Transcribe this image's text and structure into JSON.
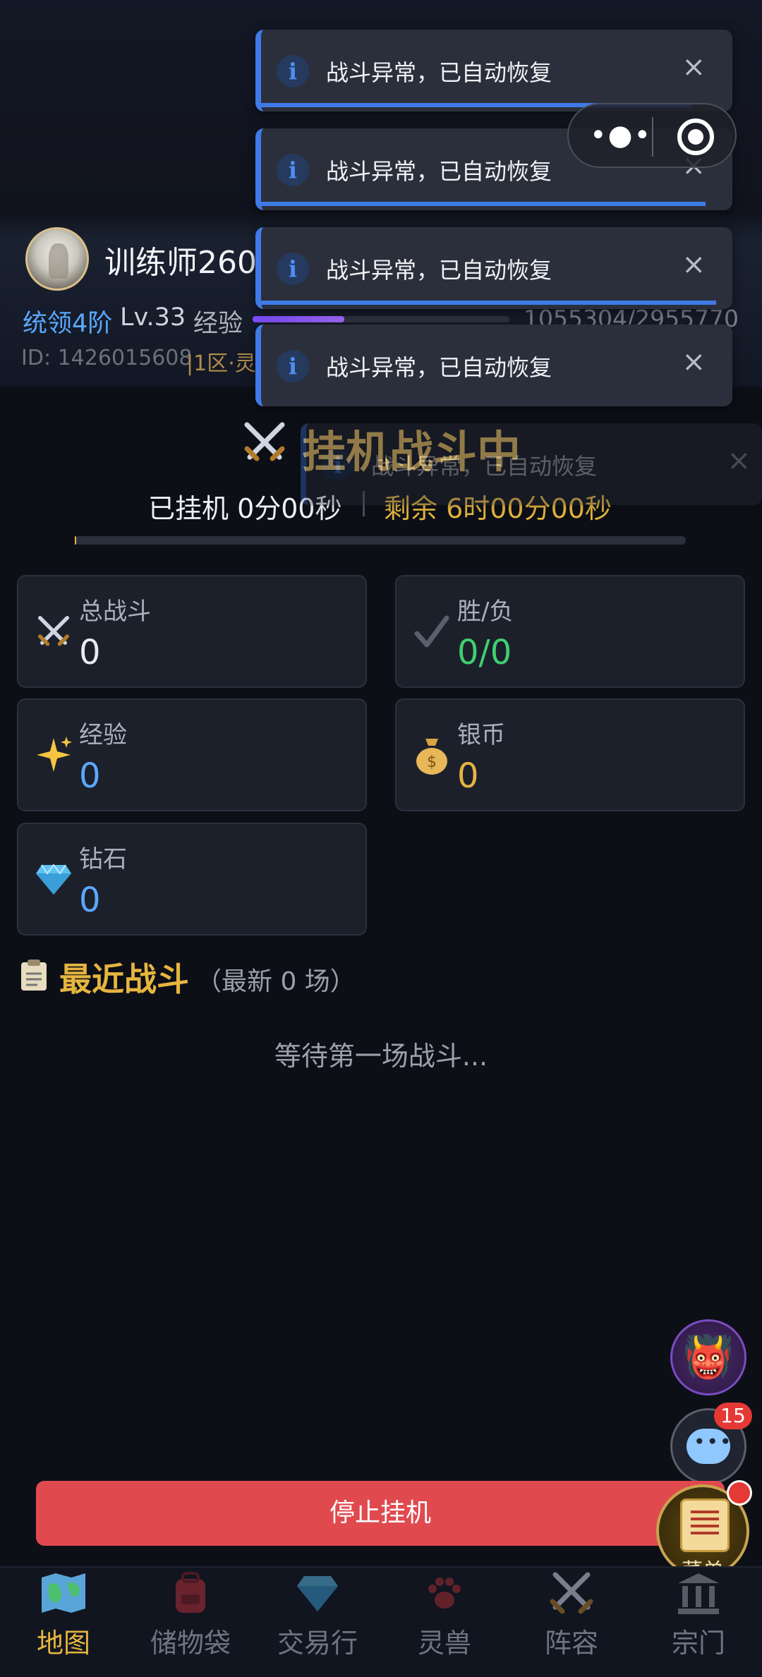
{
  "player": {
    "name": "训练师260",
    "rank": "统领4阶",
    "level": "Lv.33",
    "exp_label": "经验",
    "exp_value": "1055304/2955770",
    "exp_fraction": 0.357,
    "id": "ID: 1426015608",
    "server": "|1区·灵"
  },
  "battle": {
    "status": "挂机战斗中",
    "elapsed": "已挂机 0分00秒",
    "remaining": "剩余 6时00分00秒",
    "progress": 0
  },
  "stats": {
    "total": {
      "label": "总战斗",
      "value": "0"
    },
    "winloss": {
      "label": "胜/负",
      "value": "0/0"
    },
    "exp": {
      "label": "经验",
      "value": "0"
    },
    "silver": {
      "label": "银币",
      "value": "0"
    },
    "diamond": {
      "label": "钻石",
      "value": "0"
    }
  },
  "recent": {
    "title": "最近战斗",
    "subtitle": "（最新 0 场）",
    "empty": "等待第一场战斗..."
  },
  "toasts": [
    {
      "message": "战斗异常，已自动恢复",
      "close": "×"
    },
    {
      "message": "战斗异常，已自动恢复",
      "close": "×"
    },
    {
      "message": "战斗异常，已自动恢复",
      "close": "×"
    },
    {
      "message": "战斗异常，已自动恢复",
      "close": "×"
    },
    {
      "message": "战斗异常，已自动恢复",
      "close": "×"
    }
  ],
  "floating": {
    "chat_badge": "15",
    "menu_label": "菜单"
  },
  "stop_button": "停止挂机",
  "nav": [
    {
      "label": "地图"
    },
    {
      "label": "储物袋"
    },
    {
      "label": "交易行"
    },
    {
      "label": "灵兽"
    },
    {
      "label": "阵容"
    },
    {
      "label": "宗门"
    }
  ],
  "colors": {
    "accent_gold": "#e5b53f",
    "accent_blue": "#5aa8ff",
    "win_green": "#3fcf6e",
    "stop_red": "#e04a4f",
    "toast_blue": "#3f7be8"
  }
}
